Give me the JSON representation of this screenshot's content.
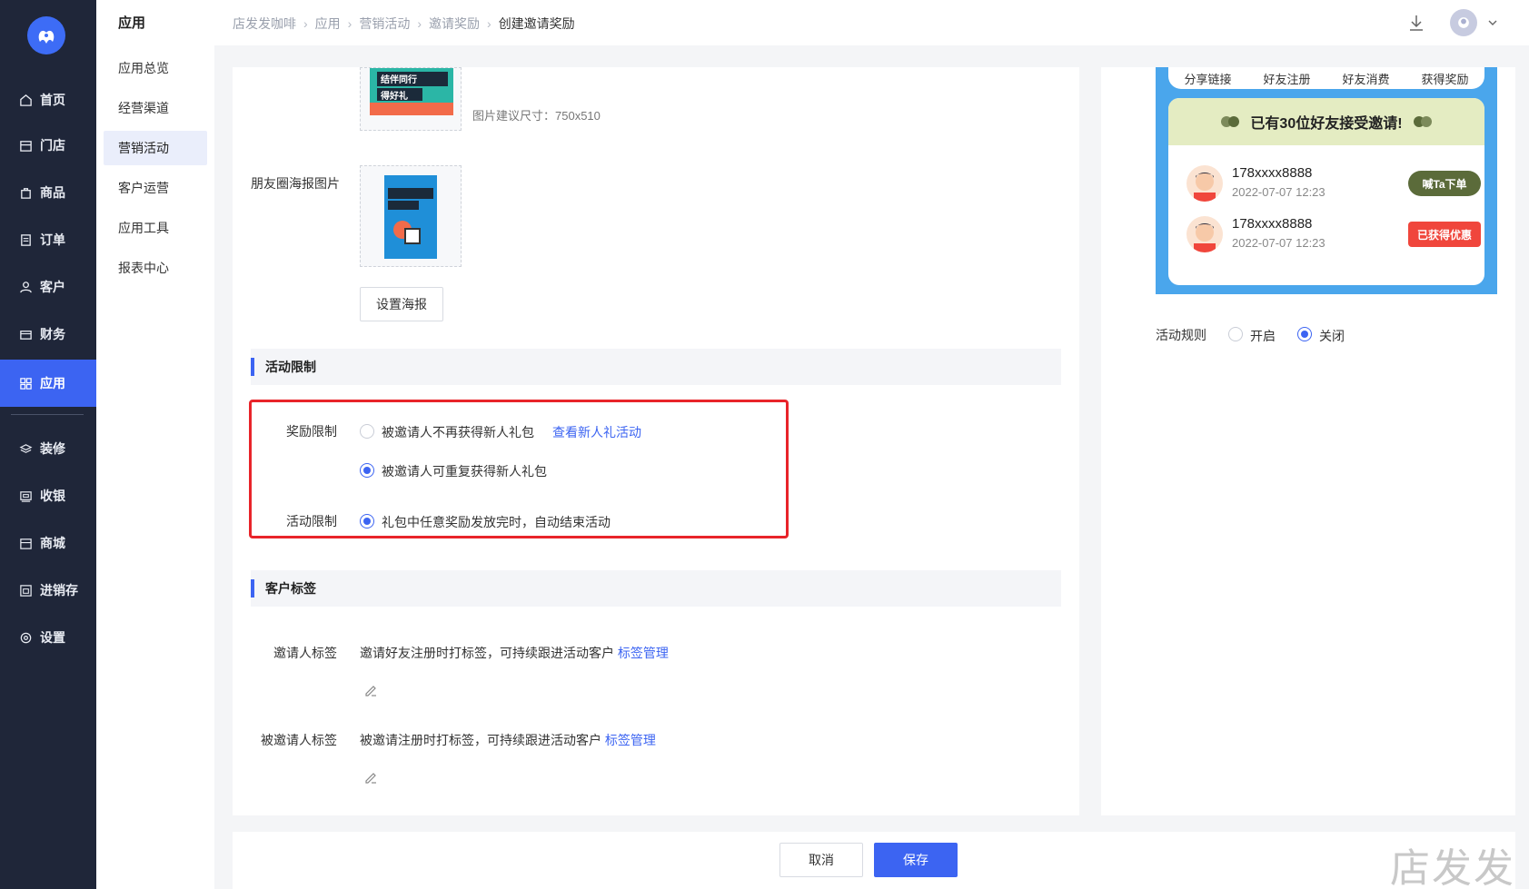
{
  "sidebar": {
    "items": [
      {
        "label": "首页",
        "icon": "home-icon"
      },
      {
        "label": "门店",
        "icon": "store-icon"
      },
      {
        "label": "商品",
        "icon": "bag-icon"
      },
      {
        "label": "订单",
        "icon": "order-icon"
      },
      {
        "label": "客户",
        "icon": "user-icon"
      },
      {
        "label": "财务",
        "icon": "wallet-icon"
      },
      {
        "label": "应用",
        "icon": "apps-icon"
      },
      {
        "label": "装修",
        "icon": "layers-icon"
      },
      {
        "label": "收银",
        "icon": "cashier-icon"
      },
      {
        "label": "商城",
        "icon": "mall-icon"
      },
      {
        "label": "进销存",
        "icon": "inventory-icon"
      },
      {
        "label": "设置",
        "icon": "settings-icon"
      }
    ],
    "active": "应用"
  },
  "subnav": {
    "title": "应用",
    "items": [
      "应用总览",
      "经营渠道",
      "营销活动",
      "客户运营",
      "应用工具",
      "报表中心"
    ],
    "active": "营销活动"
  },
  "breadcrumb": [
    "店发发咖啡",
    "应用",
    "营销活动",
    "邀请奖励",
    "创建邀请奖励"
  ],
  "poster": {
    "size_hint": "图片建议尺寸：750x510",
    "moments_label": "朋友圈海报图片",
    "set_poster_button": "设置海报"
  },
  "limits": {
    "section_title": "活动限制",
    "reward_label": "奖励限制",
    "option_no_repeat": "被邀请人不再获得新人礼包",
    "view_newcomer_link": "查看新人礼活动",
    "option_repeat": "被邀请人可重复获得新人礼包",
    "activity_label": "活动限制",
    "option_auto_end": "礼包中任意奖励发放完时，自动结束活动"
  },
  "tags": {
    "section_title": "客户标签",
    "inviter_label": "邀请人标签",
    "inviter_desc": "邀请好友注册时打标签，可持续跟进活动客户",
    "invitee_label": "被邀请人标签",
    "invitee_desc": "被邀请注册时打标签，可持续跟进活动客户",
    "manage_link": "标签管理"
  },
  "footer": {
    "cancel": "取消",
    "save": "保存"
  },
  "preview": {
    "steps": [
      "分享链接",
      "好友注册",
      "好友消费",
      "获得奖励"
    ],
    "headline": "已有30位好友接受邀请!",
    "rows": [
      {
        "phone": "178xxxx8888",
        "date": "2022-07-07 12:23",
        "action": "喊Ta下单",
        "color": "#5b6b3a"
      },
      {
        "phone": "178xxxx8888",
        "date": "2022-07-07 12:23",
        "action": "已获得优惠",
        "color": "#f0463c"
      }
    ],
    "rules_label": "活动规则",
    "rules_on": "开启",
    "rules_off": "关闭"
  },
  "poster_text": {
    "line1": "结伴同行",
    "line2": "得好礼"
  },
  "watermark": "店发发",
  "colors": {
    "accent": "#3c64f2",
    "sidebar": "#1f2639",
    "highlight": "#e8242a"
  }
}
